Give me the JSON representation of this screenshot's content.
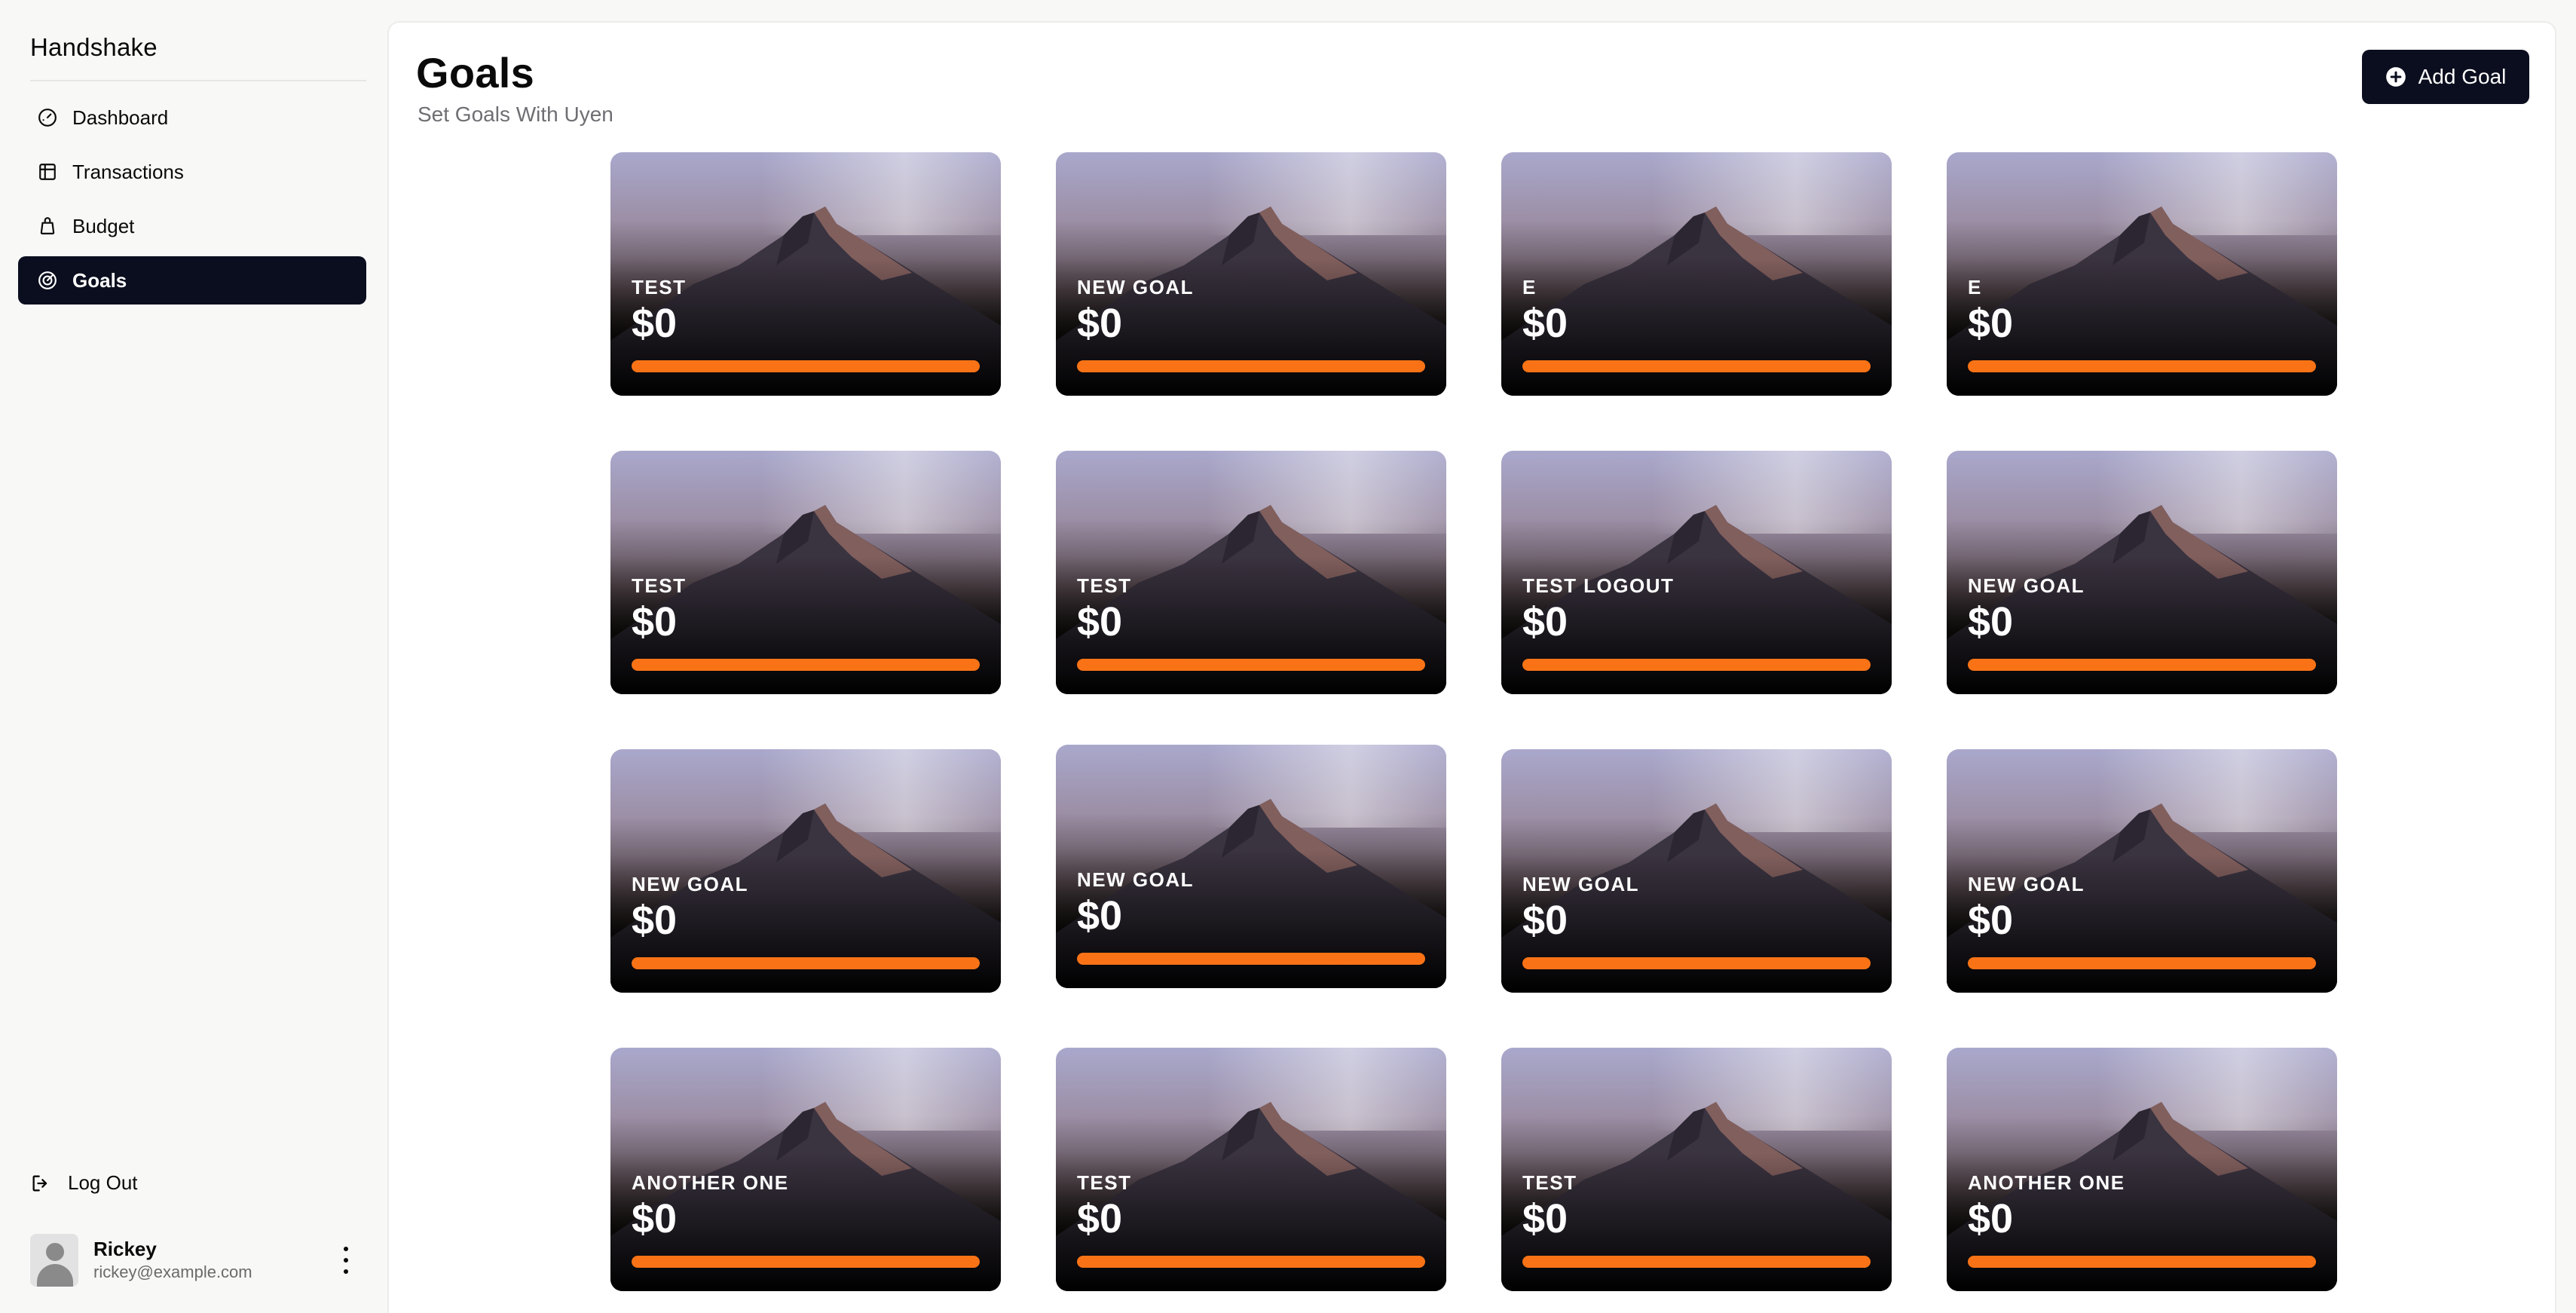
{
  "app": {
    "brand": "Handshake"
  },
  "sidebar": {
    "items": [
      {
        "label": "Dashboard",
        "icon": "gauge-icon",
        "active": false
      },
      {
        "label": "Transactions",
        "icon": "table-icon",
        "active": false
      },
      {
        "label": "Budget",
        "icon": "bag-icon",
        "active": false
      },
      {
        "label": "Goals",
        "icon": "target-icon",
        "active": true
      }
    ],
    "logout_label": "Log Out"
  },
  "user": {
    "name": "Rickey",
    "email": "rickey@example.com"
  },
  "header": {
    "title": "Goals",
    "subtitle": "Set Goals With Uyen",
    "add_button_label": "Add Goal"
  },
  "goals": [
    {
      "name": "TEST",
      "amount": "$0",
      "progress": 1.0
    },
    {
      "name": "NEW GOAL",
      "amount": "$0",
      "progress": 1.0
    },
    {
      "name": "E",
      "amount": "$0",
      "progress": 1.0
    },
    {
      "name": "E",
      "amount": "$0",
      "progress": 1.0
    },
    {
      "name": "TEST",
      "amount": "$0",
      "progress": 1.0
    },
    {
      "name": "TEST",
      "amount": "$0",
      "progress": 1.0
    },
    {
      "name": "TEST LOGOUT",
      "amount": "$0",
      "progress": 1.0
    },
    {
      "name": "NEW GOAL",
      "amount": "$0",
      "progress": 1.0
    },
    {
      "name": "NEW GOAL",
      "amount": "$0",
      "progress": 1.0
    },
    {
      "name": "NEW GOAL",
      "amount": "$0",
      "progress": 1.0
    },
    {
      "name": "NEW GOAL",
      "amount": "$0",
      "progress": 1.0
    },
    {
      "name": "NEW GOAL",
      "amount": "$0",
      "progress": 1.0
    },
    {
      "name": "ANOTHER ONE",
      "amount": "$0",
      "progress": 1.0
    },
    {
      "name": "TEST",
      "amount": "$0",
      "progress": 1.0
    },
    {
      "name": "TEST",
      "amount": "$0",
      "progress": 1.0
    },
    {
      "name": "ANOTHER ONE",
      "amount": "$0",
      "progress": 1.0
    }
  ],
  "colors": {
    "accent_dark": "#0b0e1e",
    "progress_orange": "#f97316",
    "muted_text": "#6e6e73"
  }
}
